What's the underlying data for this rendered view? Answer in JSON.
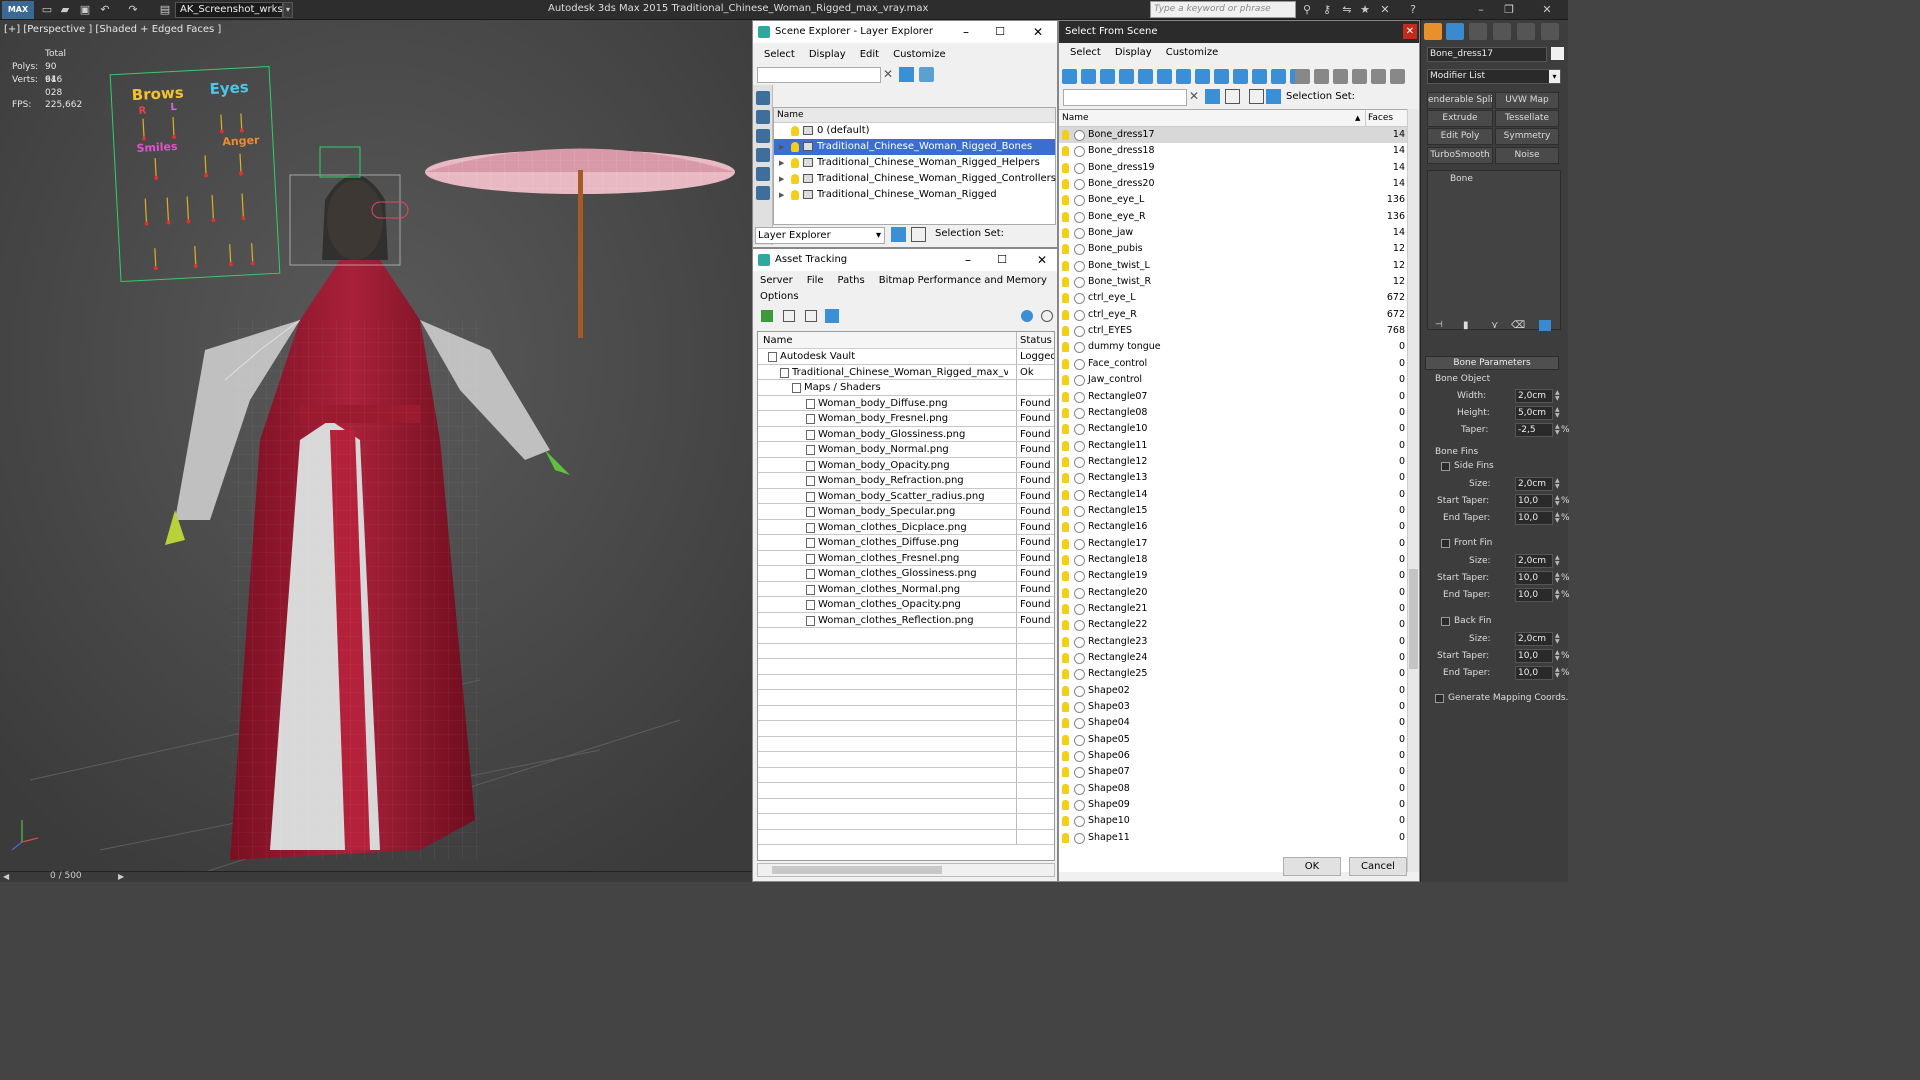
{
  "titlebar": {
    "logo": "MAX",
    "workspace": "AK_Screenshot_wrksp",
    "app_title": "Autodesk 3ds Max  2015      Traditional_Chinese_Woman_Rigged_max_vray.max",
    "search_placeholder": "Type a keyword or phrase"
  },
  "viewport": {
    "label": "[+] [Perspective ] [Shaded + Edged Faces ]",
    "stats": {
      "total": "Total",
      "polys_label": "Polys:",
      "polys": "90 616",
      "verts_label": "Verts:",
      "verts": "94 028",
      "fps_label": "FPS:",
      "fps": "225,662"
    },
    "rig_board": {
      "brows": "Brows",
      "eyes": "Eyes",
      "smiles": "Smiles",
      "anger": "Anger",
      "r": "R",
      "l": "L"
    },
    "timeline": "0 / 500"
  },
  "scene_explorer": {
    "title": "Scene Explorer - Layer Explorer",
    "menu": [
      "Select",
      "Display",
      "Edit",
      "Customize"
    ],
    "column": "Name",
    "rows": [
      {
        "name": "0 (default)",
        "selected": false
      },
      {
        "name": "Traditional_Chinese_Woman_Rigged_Bones",
        "selected": true
      },
      {
        "name": "Traditional_Chinese_Woman_Rigged_Helpers",
        "selected": false
      },
      {
        "name": "Traditional_Chinese_Woman_Rigged_Controllers",
        "selected": false
      },
      {
        "name": "Traditional_Chinese_Woman_Rigged",
        "selected": false
      }
    ],
    "footer_dropdown": "Layer Explorer",
    "selection_set": "Selection Set:"
  },
  "asset_tracking": {
    "title": "Asset Tracking",
    "menu": [
      "Server",
      "File",
      "Paths",
      "Bitmap Performance and Memory"
    ],
    "menu2": "Options",
    "col_name": "Name",
    "col_status": "Status",
    "rows": [
      {
        "name": "Autodesk Vault",
        "status": "Logged",
        "indent": 1
      },
      {
        "name": "Traditional_Chinese_Woman_Rigged_max_vray...",
        "status": "Ok",
        "indent": 2
      },
      {
        "name": "Maps / Shaders",
        "status": "",
        "indent": 3
      },
      {
        "name": "Woman_body_Diffuse.png",
        "status": "Found",
        "indent": 4
      },
      {
        "name": "Woman_body_Fresnel.png",
        "status": "Found",
        "indent": 4
      },
      {
        "name": "Woman_body_Glossiness.png",
        "status": "Found",
        "indent": 4
      },
      {
        "name": "Woman_body_Normal.png",
        "status": "Found",
        "indent": 4
      },
      {
        "name": "Woman_body_Opacity.png",
        "status": "Found",
        "indent": 4
      },
      {
        "name": "Woman_body_Refraction.png",
        "status": "Found",
        "indent": 4
      },
      {
        "name": "Woman_body_Scatter_radius.png",
        "status": "Found",
        "indent": 4
      },
      {
        "name": "Woman_body_Specular.png",
        "status": "Found",
        "indent": 4
      },
      {
        "name": "Woman_clothes_Dicplace.png",
        "status": "Found",
        "indent": 4
      },
      {
        "name": "Woman_clothes_Diffuse.png",
        "status": "Found",
        "indent": 4
      },
      {
        "name": "Woman_clothes_Fresnel.png",
        "status": "Found",
        "indent": 4
      },
      {
        "name": "Woman_clothes_Glossiness.png",
        "status": "Found",
        "indent": 4
      },
      {
        "name": "Woman_clothes_Normal.png",
        "status": "Found",
        "indent": 4
      },
      {
        "name": "Woman_clothes_Opacity.png",
        "status": "Found",
        "indent": 4
      },
      {
        "name": "Woman_clothes_Reflection.png",
        "status": "Found",
        "indent": 4
      }
    ]
  },
  "select_from_scene": {
    "title": "Select From Scene",
    "menu": [
      "Select",
      "Display",
      "Customize"
    ],
    "selection_set": "Selection Set:",
    "col_name": "Name",
    "col_faces": "Faces",
    "ok": "OK",
    "cancel": "Cancel",
    "rows": [
      {
        "name": "Bone_dress17",
        "faces": "14"
      },
      {
        "name": "Bone_dress18",
        "faces": "14"
      },
      {
        "name": "Bone_dress19",
        "faces": "14"
      },
      {
        "name": "Bone_dress20",
        "faces": "14"
      },
      {
        "name": "Bone_eye_L",
        "faces": "136"
      },
      {
        "name": "Bone_eye_R",
        "faces": "136"
      },
      {
        "name": "Bone_jaw",
        "faces": "14"
      },
      {
        "name": "Bone_pubis",
        "faces": "12"
      },
      {
        "name": "Bone_twist_L",
        "faces": "12"
      },
      {
        "name": "Bone_twist_R",
        "faces": "12"
      },
      {
        "name": "ctrl_eye_L",
        "faces": "672"
      },
      {
        "name": "ctrl_eye_R",
        "faces": "672"
      },
      {
        "name": "ctrl_EYES",
        "faces": "768"
      },
      {
        "name": "dummy tongue",
        "faces": "0"
      },
      {
        "name": "Face_control",
        "faces": "0"
      },
      {
        "name": "Jaw_control",
        "faces": "0"
      },
      {
        "name": "Rectangle07",
        "faces": "0"
      },
      {
        "name": "Rectangle08",
        "faces": "0"
      },
      {
        "name": "Rectangle10",
        "faces": "0"
      },
      {
        "name": "Rectangle11",
        "faces": "0"
      },
      {
        "name": "Rectangle12",
        "faces": "0"
      },
      {
        "name": "Rectangle13",
        "faces": "0"
      },
      {
        "name": "Rectangle14",
        "faces": "0"
      },
      {
        "name": "Rectangle15",
        "faces": "0"
      },
      {
        "name": "Rectangle16",
        "faces": "0"
      },
      {
        "name": "Rectangle17",
        "faces": "0"
      },
      {
        "name": "Rectangle18",
        "faces": "0"
      },
      {
        "name": "Rectangle19",
        "faces": "0"
      },
      {
        "name": "Rectangle20",
        "faces": "0"
      },
      {
        "name": "Rectangle21",
        "faces": "0"
      },
      {
        "name": "Rectangle22",
        "faces": "0"
      },
      {
        "name": "Rectangle23",
        "faces": "0"
      },
      {
        "name": "Rectangle24",
        "faces": "0"
      },
      {
        "name": "Rectangle25",
        "faces": "0"
      },
      {
        "name": "Shape02",
        "faces": "0"
      },
      {
        "name": "Shape03",
        "faces": "0"
      },
      {
        "name": "Shape04",
        "faces": "0"
      },
      {
        "name": "Shape05",
        "faces": "0"
      },
      {
        "name": "Shape06",
        "faces": "0"
      },
      {
        "name": "Shape07",
        "faces": "0"
      },
      {
        "name": "Shape08",
        "faces": "0"
      },
      {
        "name": "Shape09",
        "faces": "0"
      },
      {
        "name": "Shape10",
        "faces": "0"
      },
      {
        "name": "Shape11",
        "faces": "0"
      }
    ]
  },
  "command_panel": {
    "object_name": "Bone_dress17",
    "modifier_list": "Modifier List",
    "buttons": [
      "enderable Spli",
      "UVW Map",
      "Extrude",
      "Tessellate",
      "Edit Poly",
      "Symmetry",
      "TurboSmooth",
      "Noise"
    ],
    "stack_item": "Bone",
    "bone_params": {
      "title": "Bone Parameters",
      "bone_object": "Bone Object",
      "width_label": "Width:",
      "width": "2,0cm",
      "height_label": "Height:",
      "height": "5,0cm",
      "taper_label": "Taper:",
      "taper": "-2,5",
      "bone_fins": "Bone Fins",
      "side_fins": "Side Fins",
      "front_fin": "Front Fin",
      "back_fin": "Back Fin",
      "size_label": "Size:",
      "size": "2,0cm",
      "start_taper_label": "Start Taper:",
      "end_taper_label": "End Taper:",
      "taper_val": "10,0",
      "pct": "%",
      "gen_mapping": "Generate Mapping Coords."
    }
  }
}
